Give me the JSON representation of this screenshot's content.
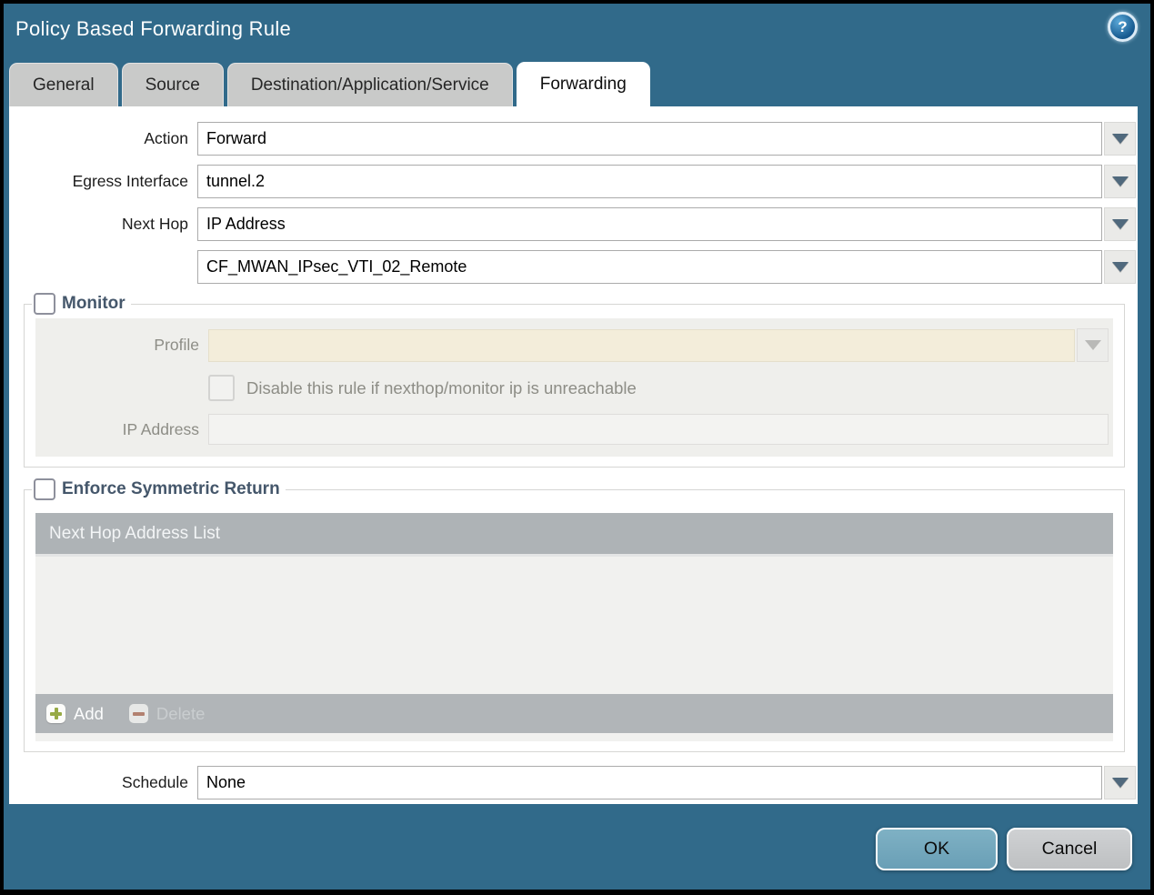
{
  "dialog": {
    "title": "Policy Based Forwarding Rule",
    "help_icon": "?",
    "colors": {
      "titlebar": "#316a8a",
      "active_tab": "#ffffff",
      "inactive_tab": "#c9cac9",
      "disabled_field": "#f3edda",
      "table_header": "#aeb3b6",
      "ok_button": "#74a9bd",
      "cancel_button": "#c6c8ca",
      "add_plus": "#97aa45",
      "delete_minus": "#b28170"
    }
  },
  "tabs": [
    {
      "label": "General",
      "active": false
    },
    {
      "label": "Source",
      "active": false
    },
    {
      "label": "Destination/Application/Service",
      "active": false
    },
    {
      "label": "Forwarding",
      "active": true
    }
  ],
  "form": {
    "action": {
      "label": "Action",
      "value": "Forward"
    },
    "egress_interface": {
      "label": "Egress Interface",
      "value": "tunnel.2"
    },
    "next_hop": {
      "label": "Next Hop",
      "value": "IP Address"
    },
    "next_hop_address": {
      "label": "",
      "value": "CF_MWAN_IPsec_VTI_02_Remote"
    },
    "schedule": {
      "label": "Schedule",
      "value": "None"
    }
  },
  "monitor": {
    "legend": "Monitor",
    "checked": false,
    "profile": {
      "label": "Profile",
      "value": ""
    },
    "disable_rule": {
      "label": "Disable this rule if nexthop/monitor ip is unreachable",
      "checked": false
    },
    "ip_address": {
      "label": "IP Address",
      "value": ""
    }
  },
  "enforce_symmetric_return": {
    "legend": "Enforce Symmetric Return",
    "checked": false,
    "table": {
      "header": "Next Hop Address List",
      "rows": []
    },
    "add_label": "Add",
    "delete_label": "Delete"
  },
  "footer": {
    "ok_label": "OK",
    "cancel_label": "Cancel"
  }
}
